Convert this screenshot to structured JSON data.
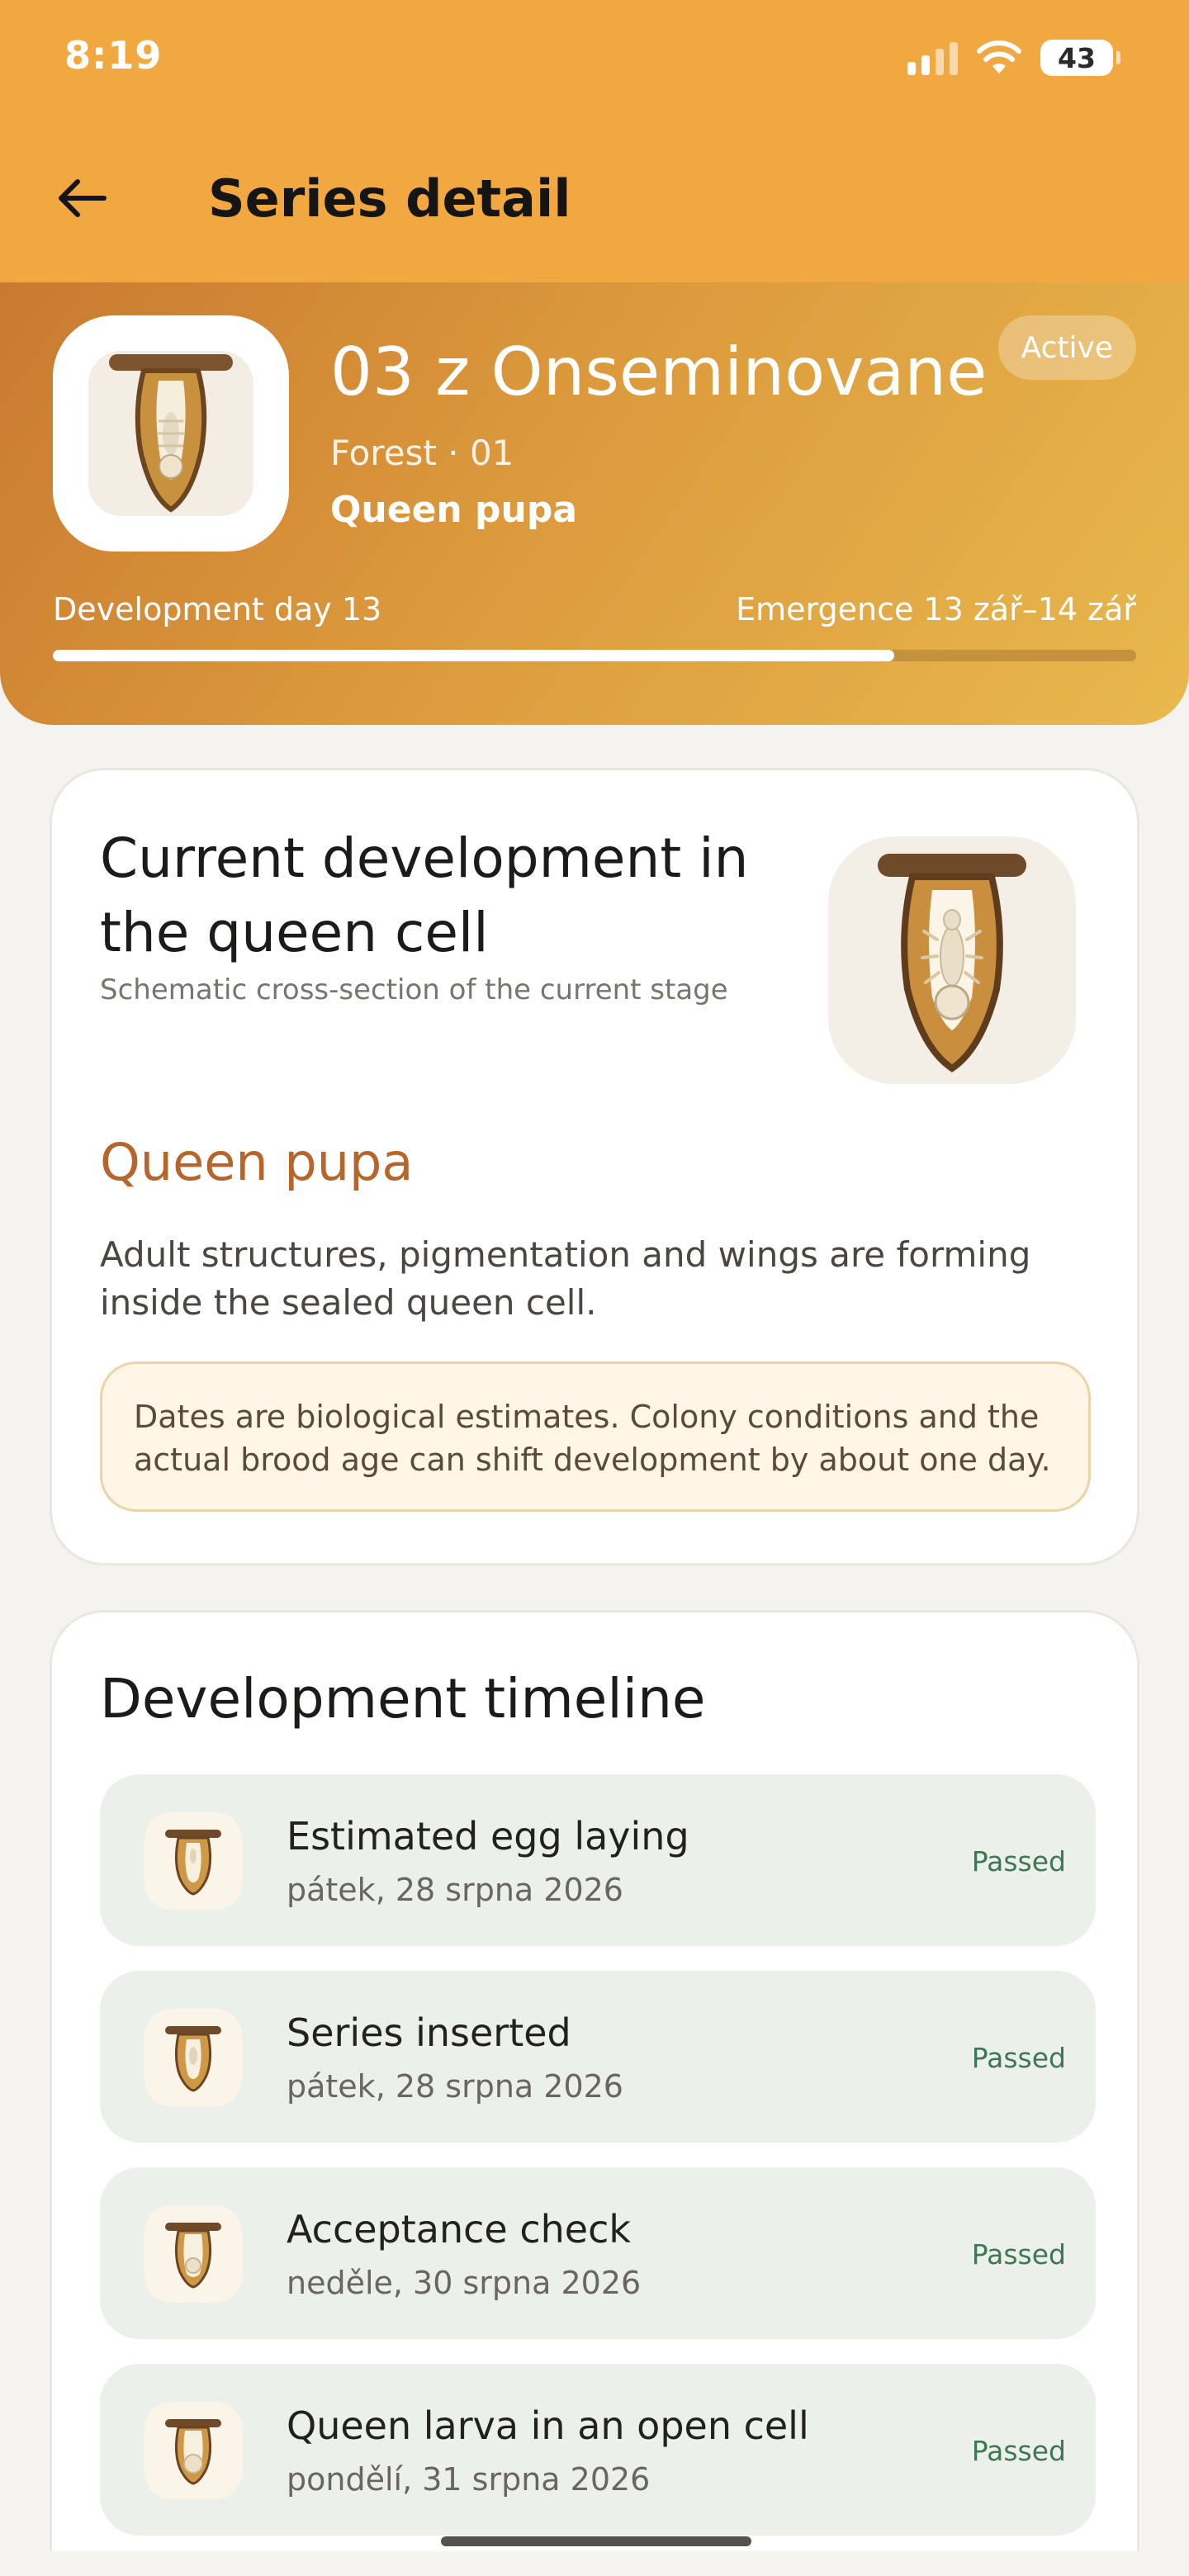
{
  "status_bar": {
    "time": "8:19",
    "battery": "43"
  },
  "app_bar": {
    "title": "Series detail",
    "back_icon": "arrow-left-icon"
  },
  "hero": {
    "series_name": "03 z Onseminovane",
    "meta": "Forest · 01",
    "stage": "Queen pupa",
    "status": "Active",
    "development_day": "Development day 13",
    "emergence": "Emergence 13 zář–14 zář",
    "progress_fraction": 0.777,
    "icon": "queen-cell-pupa-icon"
  },
  "development_card": {
    "title": "Current development in the queen cell",
    "subtitle": "Schematic cross-section of the current stage",
    "stage_name": "Queen pupa",
    "stage_description": "Adult structures, pigmentation and wings are forming inside the sealed queen cell.",
    "notice": "Dates are biological estimates. Colony conditions and the actual brood age can shift development by about one day.",
    "icon": "queen-cell-cross-section-icon"
  },
  "timeline": {
    "title": "Development timeline",
    "items": [
      {
        "title": "Estimated egg laying",
        "date": "pátek, 28 srpna 2026",
        "status": "Passed",
        "icon": "egg-cell-icon"
      },
      {
        "title": "Series inserted",
        "date": "pátek, 28 srpna 2026",
        "status": "Passed",
        "icon": "inserted-cell-icon"
      },
      {
        "title": "Acceptance check",
        "date": "neděle, 30 srpna 2026",
        "status": "Passed",
        "icon": "acceptance-cell-icon"
      },
      {
        "title": "Queen larva in an open cell",
        "date": "pondělí, 31 srpna 2026",
        "status": "Passed",
        "icon": "larva-cell-icon"
      }
    ]
  },
  "colors": {
    "app_bar": "#f2a840",
    "hero_start": "#c97a30",
    "hero_end": "#e8b84e",
    "accent_text": "#b6662a",
    "passed": "#3e7656",
    "timeline_row": "#ebf0eb",
    "notice_bg": "#fff6e8"
  }
}
